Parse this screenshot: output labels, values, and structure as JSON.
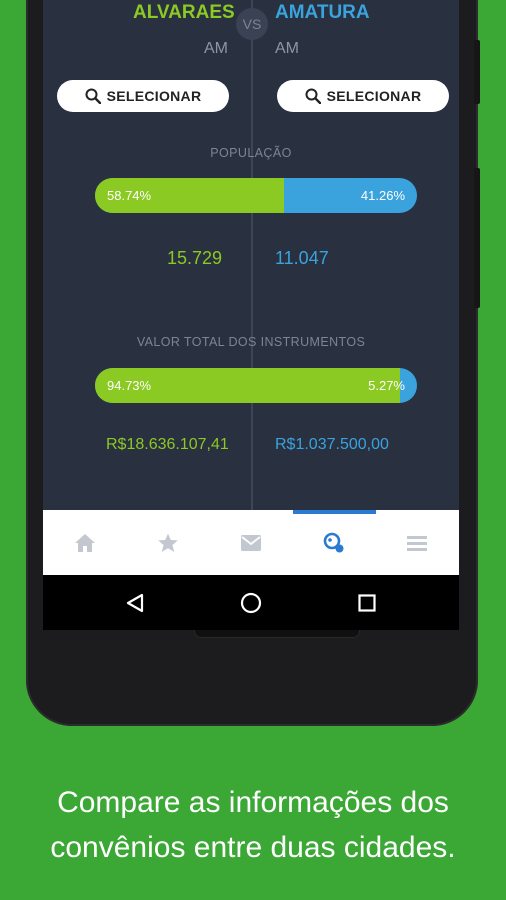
{
  "compare": {
    "left_city": "ALVARAES",
    "right_city": "AMATURA",
    "vs_label": "VS",
    "left_state": "AM",
    "right_state": "AM",
    "select_label": "SELECIONAR"
  },
  "population": {
    "title": "POPULAÇÃO",
    "left_fraction": 0.5874,
    "left_pct": "58.74%",
    "right_pct": "41.26%",
    "left_value": "15.729",
    "right_value": "11.047"
  },
  "instruments": {
    "title": "VALOR TOTAL DOS INSTRUMENTOS",
    "left_fraction": 0.9473,
    "left_pct": "94.73%",
    "right_pct": "5.27%",
    "left_value": "R$18.636.107,41",
    "right_value": "R$1.037.500,00"
  },
  "nav": {
    "items": [
      "home-icon",
      "star-icon",
      "mail-icon",
      "compare-icon",
      "menu-icon"
    ],
    "active_index": 3
  },
  "colors": {
    "green": "#8bc923",
    "blue": "#3aa3dd",
    "background": "#3ba735",
    "screen": "#293040"
  },
  "caption": {
    "line1": "Compare as informações dos",
    "line2": "convênios entre duas cidades."
  }
}
